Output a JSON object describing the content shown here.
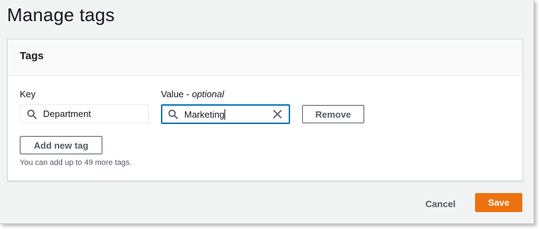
{
  "page": {
    "title": "Manage tags"
  },
  "panel": {
    "title": "Tags"
  },
  "form": {
    "key_label": "Key",
    "value_label": "Value - ",
    "value_label_optional": "optional",
    "key_value": "Department",
    "value_value": "Marketing",
    "remove_label": "Remove",
    "add_label": "Add new tag",
    "hint": "You can add up to 49 more tags."
  },
  "footer": {
    "cancel_label": "Cancel",
    "save_label": "Save"
  },
  "icons": {
    "search": "search-icon",
    "clear": "close-icon"
  },
  "colors": {
    "accent": "#0073bb",
    "primary": "#ec7211",
    "text": "#16191f",
    "secondary": "#545b64"
  }
}
